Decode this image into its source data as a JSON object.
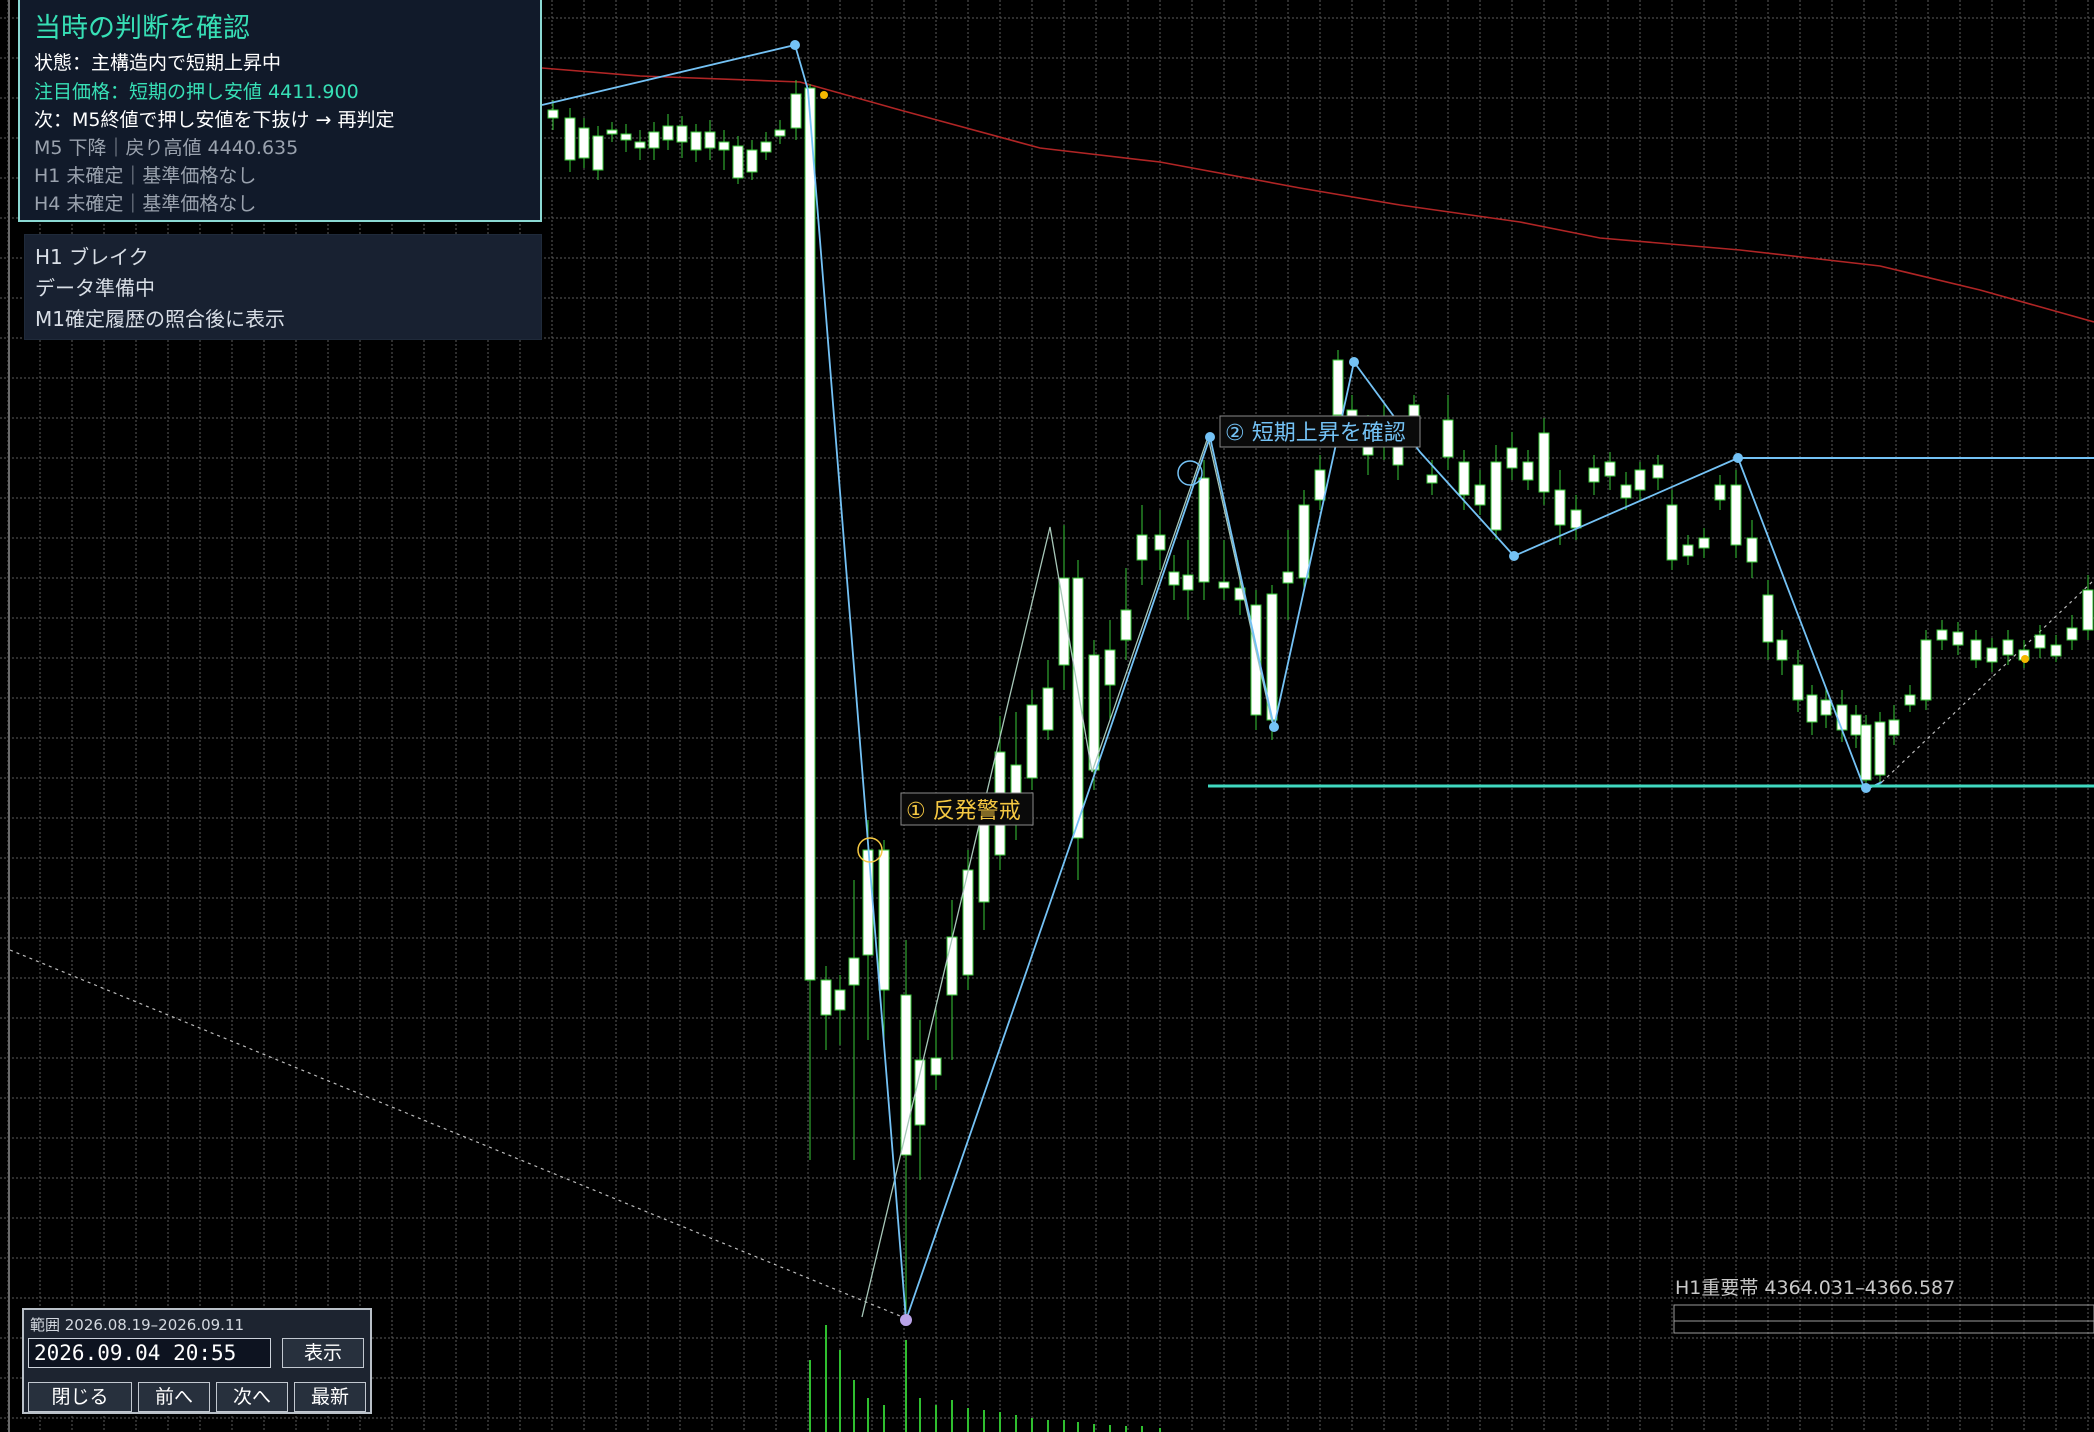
{
  "status_panel": {
    "title": "当時の判断を確認",
    "state": "状態：主構造内で短期上昇中",
    "focus_price": "注目価格：短期の押し安値  4411.900",
    "next": "次：M5終値で押し安値を下抜け → 再判定",
    "m5": "M5 下降｜戻り高値 4440.635",
    "h1": "H1 未確定｜基準価格なし",
    "h4": "H4 未確定｜基準価格なし"
  },
  "break_panel": {
    "title": "H1 ブレイク",
    "line1": "データ準備中",
    "line2": "M1確定履歴の照合後に表示"
  },
  "chart": {
    "label_1": "① 反発警戒",
    "label_2": "② 短期上昇を確認",
    "important_zone": "H1重要帯 4364.031–4366.587",
    "colors": {
      "background": "#000000",
      "grid": "#5c5c5c",
      "bull_candle": "#ffffff",
      "wick": "#38c938",
      "zigzag": "#74c2f5",
      "ma_line": "#b02525",
      "support_line": "#40d9c0",
      "label_1": "#f5c842",
      "label_2": "#74c2f5",
      "volume": "#2fbf2f"
    }
  },
  "nav_panel": {
    "range": "範囲 2026.08.19–2026.09.11",
    "datetime": "2026.09.04 20:55",
    "show_button": "表示",
    "close_button": "閉じる",
    "prev_button": "前へ",
    "next_button": "次へ",
    "latest_button": "最新"
  }
}
